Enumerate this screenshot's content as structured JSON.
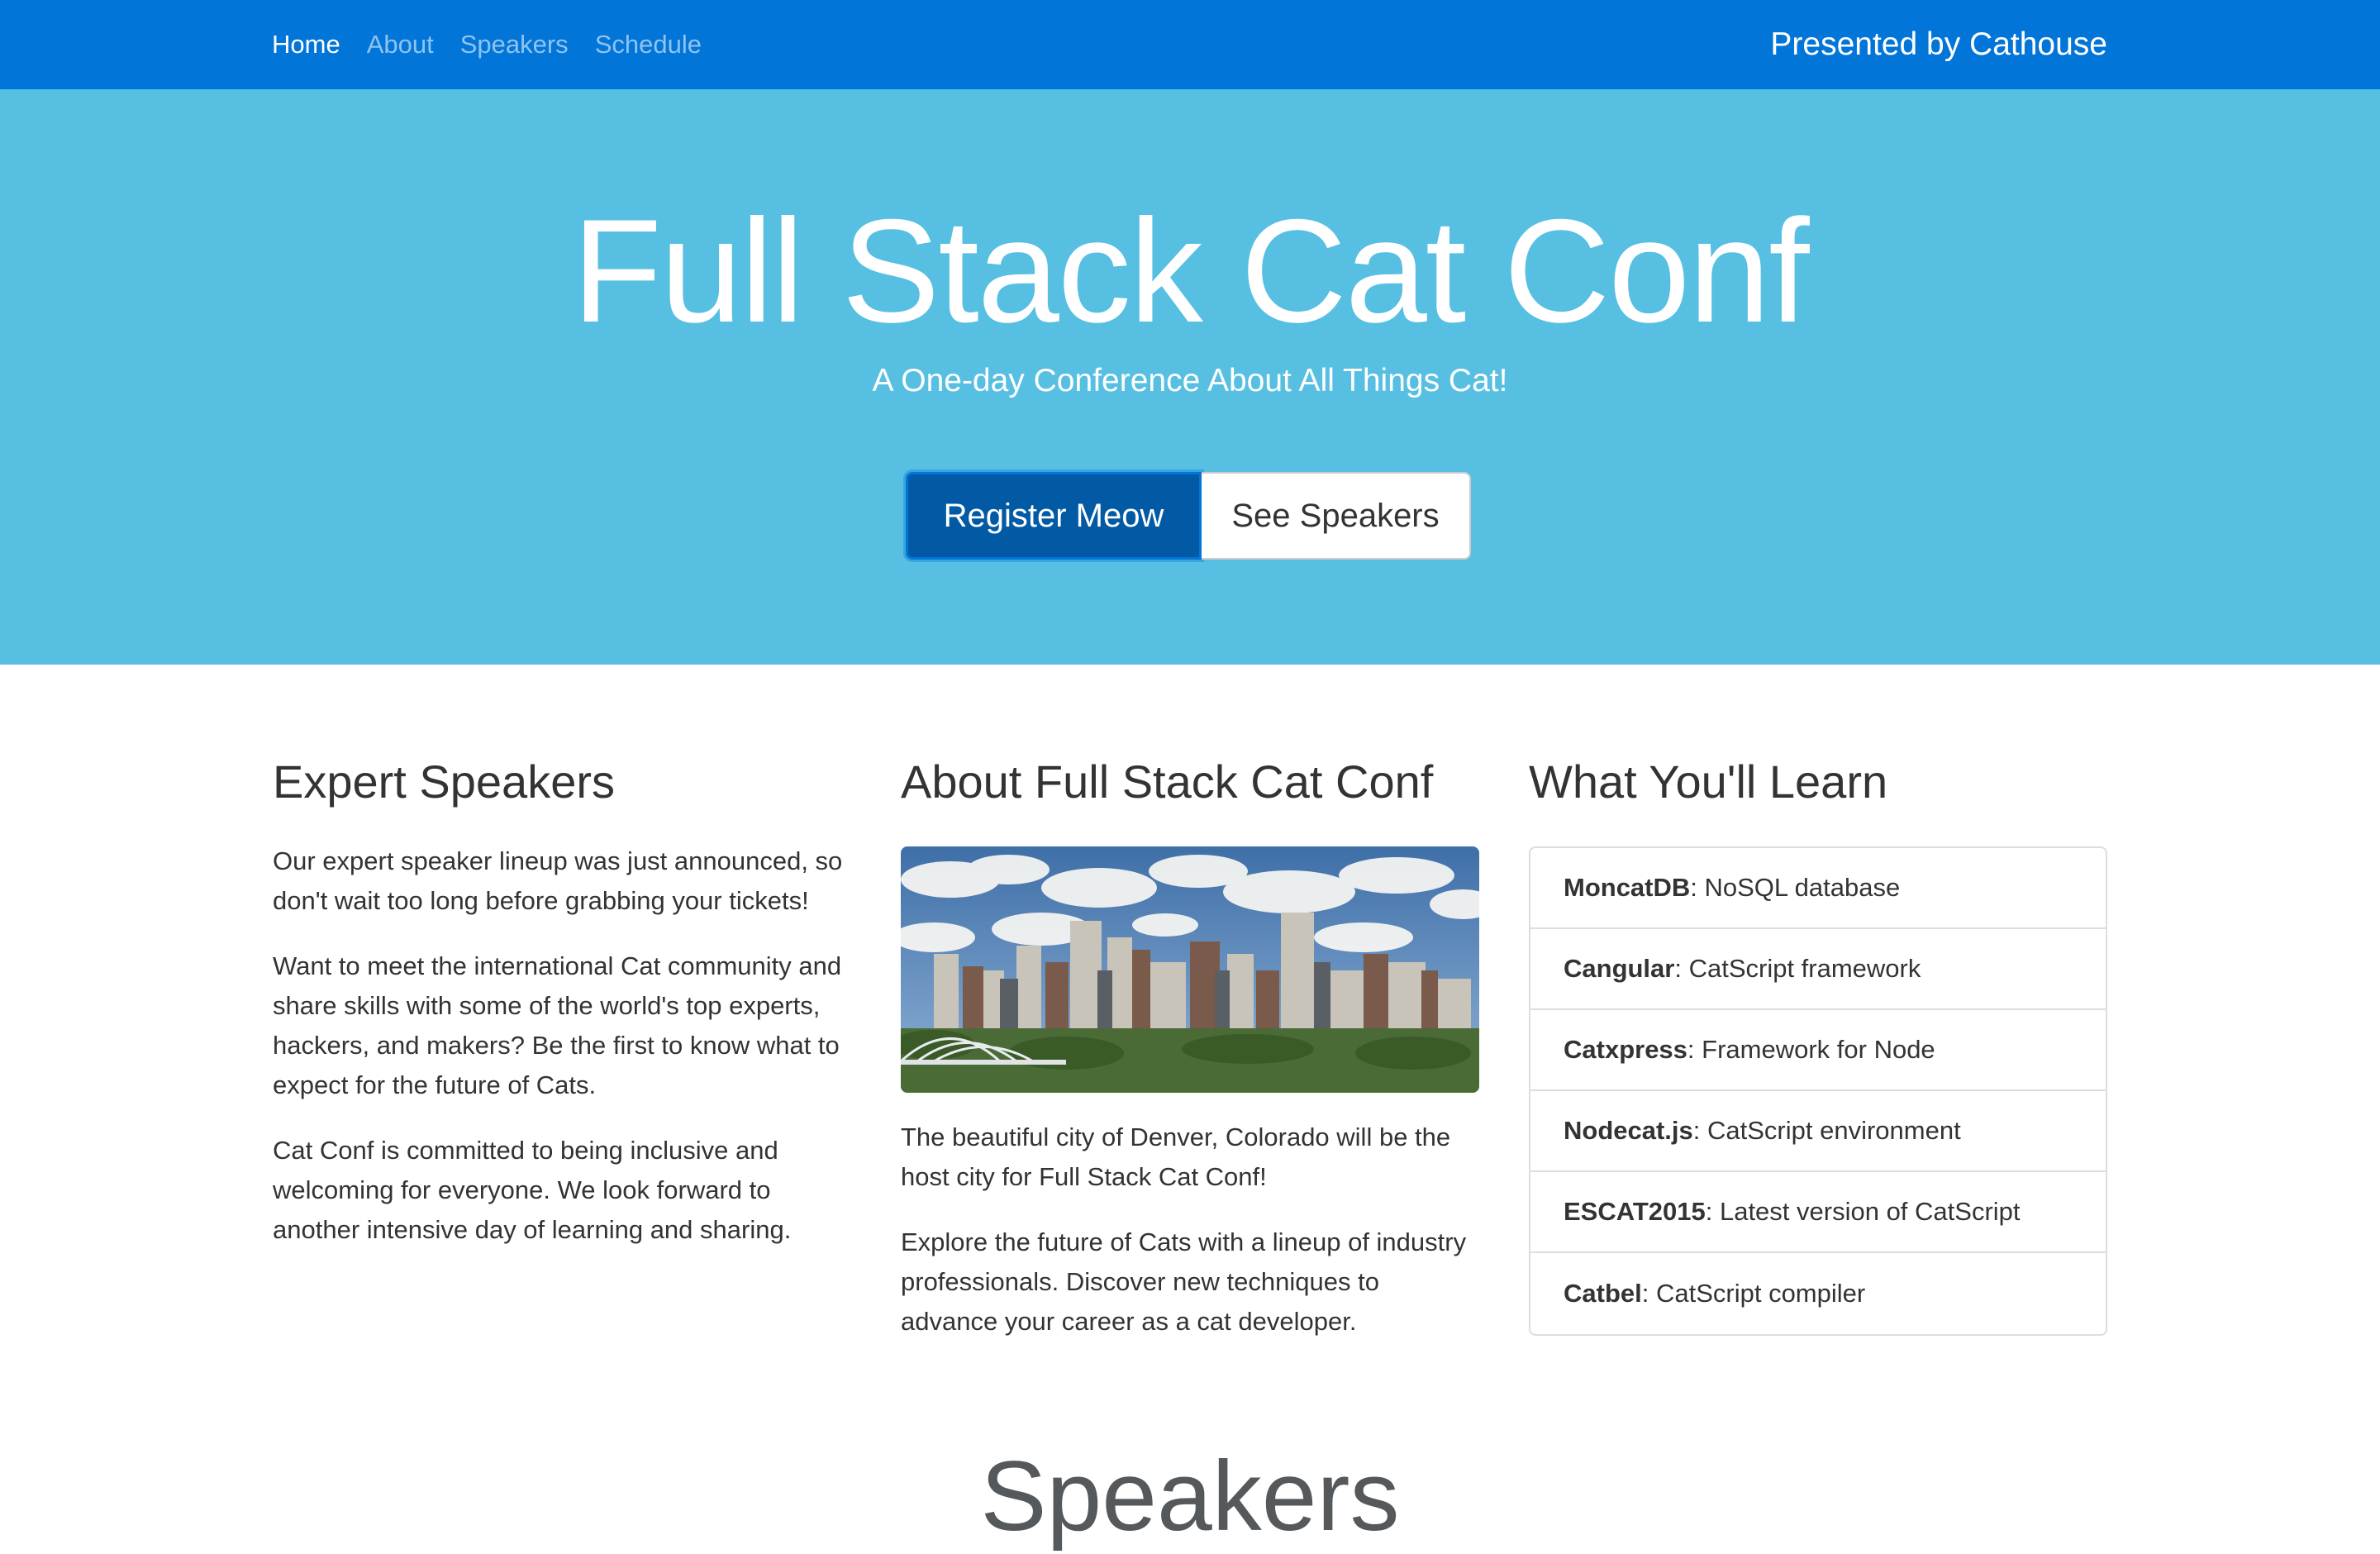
{
  "nav": {
    "links": [
      "Home",
      "About",
      "Speakers",
      "Schedule"
    ],
    "presented_by": "Presented by Cathouse"
  },
  "hero": {
    "title": "Full Stack Cat Conf",
    "subtitle": "A One-day Conference About All Things Cat!",
    "primary_button": "Register Meow",
    "secondary_button": "See Speakers"
  },
  "columns": {
    "speakers": {
      "heading": "Expert Speakers",
      "paragraphs": [
        "Our expert speaker lineup was just announced, so don't wait too long before grabbing your tickets!",
        "Want to meet the international Cat community and share skills with some of the world's top experts, hackers, and makers? Be the first to know what to expect for the future of Cats.",
        "Cat Conf is committed to being inclusive and welcoming for everyone. We look forward to another intensive day of learning and sharing."
      ]
    },
    "about": {
      "heading": "About Full Stack Cat Conf",
      "image_alt": "Denver skyline",
      "paragraphs": [
        "The beautiful city of Denver, Colorado will be the host city for Full Stack Cat Conf!",
        "Explore the future of Cats with a lineup of industry professionals. Discover new techniques to advance your career as a cat developer."
      ]
    },
    "learn": {
      "heading": "What You'll Learn",
      "items": [
        {
          "name": "MoncatDB",
          "desc": ": NoSQL database"
        },
        {
          "name": "Cangular",
          "desc": ": CatScript framework"
        },
        {
          "name": "Catxpress",
          "desc": ": Framework for Node"
        },
        {
          "name": "Nodecat.js",
          "desc": ": CatScript environment"
        },
        {
          "name": "ESCAT2015",
          "desc": ": Latest version of CatScript"
        },
        {
          "name": "Catbel",
          "desc": ": CatScript compiler"
        }
      ]
    }
  },
  "next_section_heading": "Speakers",
  "colors": {
    "navbar": "#0275d8",
    "hero": "#56bfe2",
    "primary_button": "#025aa5"
  }
}
